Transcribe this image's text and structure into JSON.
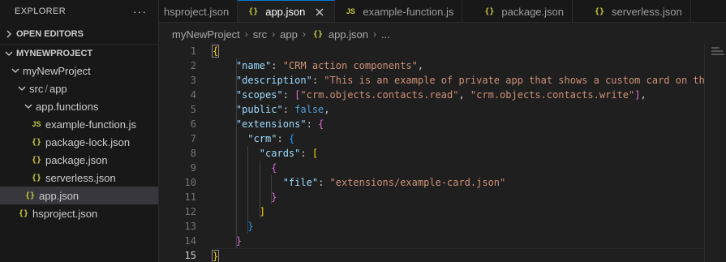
{
  "sidebar": {
    "title": "EXPLORER",
    "more": "···",
    "open_editors_label": "OPEN EDITORS",
    "project_label": "MYNEWPROJECT",
    "tree": {
      "root_folder": "myNewProject",
      "src_folder": "src",
      "app_folder": "app",
      "functions_folder": "app.functions",
      "file_example_function": "example-function.js",
      "file_package_lock": "package-lock.json",
      "file_package": "package.json",
      "file_serverless": "serverless.json",
      "file_app": "app.json",
      "file_hsproject": "hsproject.json"
    }
  },
  "tabs": [
    {
      "label": "hsproject.json",
      "icon": "{}"
    },
    {
      "label": "app.json",
      "icon": "{}"
    },
    {
      "label": "example-function.js",
      "icon": "JS"
    },
    {
      "label": "package.json",
      "icon": "{}"
    },
    {
      "label": "serverless.json",
      "icon": "{}"
    }
  ],
  "breadcrumb": {
    "items": [
      "myNewProject",
      "src",
      "app"
    ],
    "file": "app.json",
    "tail": "..."
  },
  "editor": {
    "line_numbers": [
      "1",
      "2",
      "3",
      "4",
      "5",
      "6",
      "7",
      "8",
      "9",
      "10",
      "11",
      "12",
      "13",
      "14",
      "15"
    ],
    "current_line": 15,
    "code": {
      "l1_open": "{",
      "k_name": "\"name\"",
      "v_name": "\"CRM action components\"",
      "k_description": "\"description\"",
      "v_description": "\"This is an example of private app that shows a custom card on th",
      "k_scopes": "\"scopes\"",
      "v_scope1": "\"crm.objects.contacts.read\"",
      "v_scope2": "\"crm.objects.contacts.write\"",
      "k_public": "\"public\"",
      "v_public": "false",
      "k_extensions": "\"extensions\"",
      "k_crm": "\"crm\"",
      "k_cards": "\"cards\"",
      "k_file": "\"file\"",
      "v_file": "\"extensions/example-card.json\"",
      "l15_close": "}"
    }
  },
  "colors": {
    "accent": "#0078d4",
    "json_icon": "#cbcb41",
    "key": "#9cdcfe",
    "string": "#ce9178",
    "keyword": "#569cd6"
  }
}
